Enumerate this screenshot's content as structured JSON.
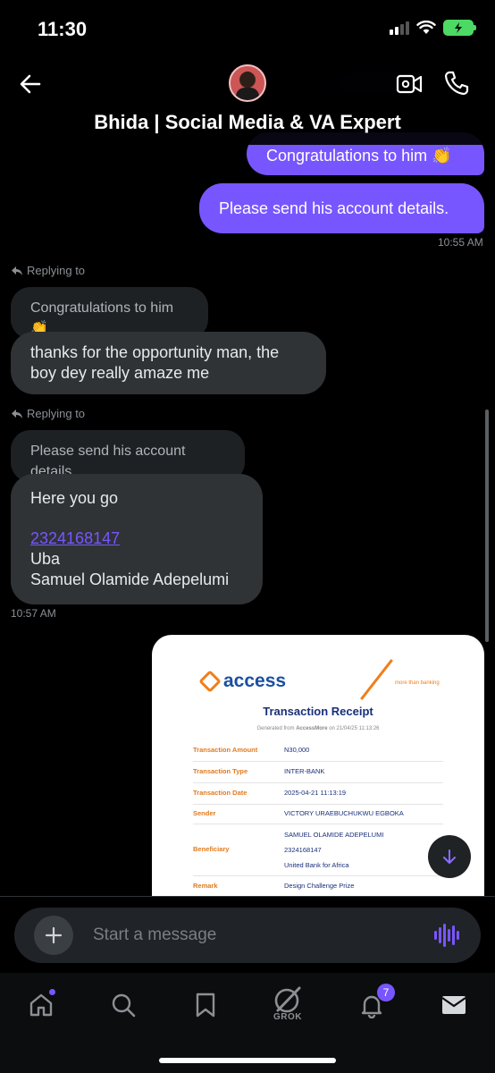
{
  "status_bar": {
    "time": "11:30"
  },
  "header": {
    "title": "Bhida | Social Media & VA Expert"
  },
  "messages": {
    "out_1": "Congratulations to him 👏",
    "out_2": "Please send his account details.",
    "out_time": "10:55 AM",
    "reply_label_1": "Replying to",
    "quoted_1": "Congratulations to him 👏",
    "in_1": "thanks for the opportunity man, the boy dey really amaze me",
    "reply_label_2": "Replying to",
    "quoted_2": "Please send his account details.",
    "in_2_line1": "Here you go",
    "in_2_account": "2324168147",
    "in_2_bank": "Uba",
    "in_2_name": "Samuel Olamide Adepelumi",
    "in_time": "10:57 AM"
  },
  "receipt": {
    "brand": "access",
    "tagline": "more than banking",
    "title": "Transaction Receipt",
    "generated_prefix": "Generated from",
    "generated_app": "AccessMore",
    "generated_suffix": "on 21/04/25 11:13:26",
    "rows": [
      {
        "label": "Transaction Amount",
        "value": "N30,000"
      },
      {
        "label": "Transaction Type",
        "value": "INTER-BANK"
      },
      {
        "label": "Transaction Date",
        "value": "2025-04-21 11:13:19"
      },
      {
        "label": "Sender",
        "value": "VICTORY URAEBUCHUKWU EGBOKA"
      },
      {
        "label": "Beneficiary",
        "value": "SAMUEL OLAMIDE ADEPELUMI",
        "value2": "2324168147",
        "value3": "United Bank for Africa"
      },
      {
        "label": "Remark",
        "value": "Design Challenge Prize"
      }
    ]
  },
  "composer": {
    "placeholder": "Start a message"
  },
  "tabbar": {
    "grok_label": "GROK",
    "notification_count": "7"
  },
  "colors": {
    "accent": "#7856ff",
    "bubble_in": "#2f3336",
    "access_orange": "#f07f1b",
    "access_blue": "#1a4fa0"
  }
}
